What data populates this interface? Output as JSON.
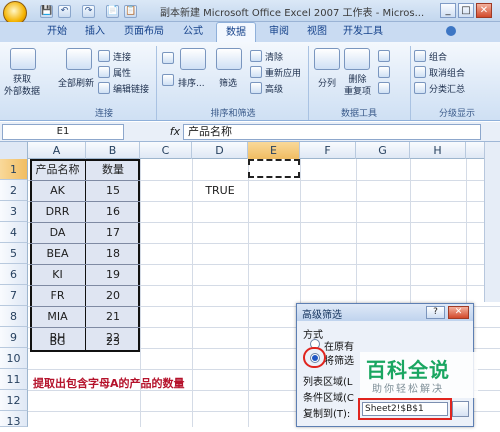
{
  "window": {
    "title": "副本新建 Microsoft Office Excel 2007 工作表 - Micros...",
    "min": "_",
    "max": "□",
    "close": "✕"
  },
  "quick_access": [
    "💾",
    "↶",
    "↷",
    "📄",
    "📋"
  ],
  "tabs": [
    "开始",
    "插入",
    "页面布局",
    "公式",
    "数据",
    "审阅",
    "视图",
    "开发工具"
  ],
  "active_tab": "数据",
  "ribbon": {
    "get_external": "获取\n外部数据",
    "refresh_all": "全部刷新",
    "connections": "连接",
    "properties": "属性",
    "edit_links": "编辑链接",
    "sort": "排序...",
    "filter": "筛选",
    "clear": "清除",
    "reapply": "重新应用",
    "advanced": "高级",
    "split_columns": "分列",
    "remove_duplicates": "删除\n重复项",
    "group": "组合",
    "ungroup": "取消组合",
    "subtotal": "分类汇总",
    "groups": {
      "connections": "连接",
      "sort_filter": "排序和筛选",
      "data_tools": "数据工具",
      "outline": "分级显示"
    }
  },
  "formula_bar": {
    "name_box": "E1",
    "fx": "fx",
    "value": "产品名称"
  },
  "columns": [
    "A",
    "B",
    "C",
    "D",
    "E",
    "F",
    "G",
    "H"
  ],
  "selected_column": "E",
  "rows": [
    "1",
    "2",
    "3",
    "4",
    "5",
    "6",
    "7",
    "8",
    "9",
    "10",
    "11",
    "12",
    "13"
  ],
  "table": {
    "headers": [
      "产品名称",
      "数量"
    ],
    "rows": [
      [
        "AK",
        "15"
      ],
      [
        "DRR",
        "16"
      ],
      [
        "DA",
        "17"
      ],
      [
        "BEA",
        "18"
      ],
      [
        "KI",
        "19"
      ],
      [
        "FR",
        "20"
      ],
      [
        "MIA",
        "21"
      ],
      [
        "BH",
        "22"
      ],
      [
        "BG",
        "23"
      ]
    ]
  },
  "d2_value": "TRUE",
  "note": "提取出包含字母A的产品的数量",
  "dialog": {
    "title": "高级筛选",
    "help": "?",
    "close": "✕",
    "mode_label": "方式",
    "option_inplace": "在原有",
    "option_copy": "将筛选",
    "list_range": "列表区域(L",
    "criteria_range": "条件区域(C",
    "copy_to": "复制到(T):",
    "copy_to_value": "Sheet2!$B$1"
  },
  "watermark": {
    "main": "百科全说",
    "sub": "助你轻松解决"
  },
  "colors": {
    "accent": "#15428b",
    "note_red": "#b5122b",
    "highlight_red": "#e0241e",
    "watermark_green": "#1aa661"
  }
}
